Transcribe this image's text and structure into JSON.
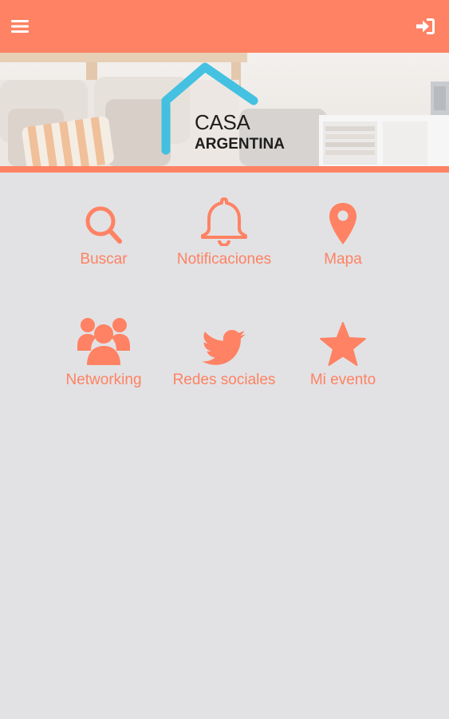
{
  "header": {
    "menu_icon": "hamburger-menu-icon",
    "login_icon": "sign-in-icon",
    "accent_color": "#fe8263"
  },
  "banner": {
    "logo_line1": "CASA",
    "logo_line2": "ARGENTINA"
  },
  "menu": [
    {
      "label": "Buscar",
      "icon": "search-icon"
    },
    {
      "label": "Notificaciones",
      "icon": "bell-icon"
    },
    {
      "label": "Mapa",
      "icon": "map-pin-icon"
    },
    {
      "label": "Networking",
      "icon": "users-icon"
    },
    {
      "label": "Redes sociales",
      "icon": "twitter-icon"
    },
    {
      "label": "Mi evento",
      "icon": "star-icon"
    }
  ],
  "colors": {
    "accent": "#fe8263",
    "background": "#e2e2e4",
    "logo_blue": "#3bbfe0"
  }
}
